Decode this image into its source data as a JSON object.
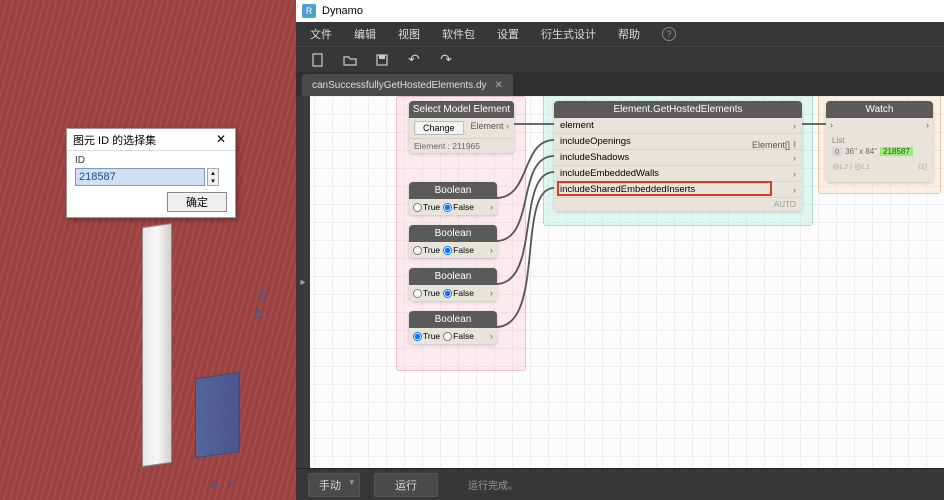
{
  "dialog": {
    "title": "图元 ID 的选择集",
    "id_label": "ID",
    "id_value": "218587",
    "ok_label": "确定"
  },
  "revit": {
    "dim1": "13' - 0\"",
    "dim2": "3' - 9\""
  },
  "dynamo": {
    "app_title": "Dynamo",
    "menu": {
      "file": "文件",
      "edit": "编辑",
      "view": "视图",
      "packages": "软件包",
      "settings": "设置",
      "generative": "衍生式设计",
      "help": "帮助"
    },
    "tab": {
      "name": "canSuccessfullyGetHostedElements.dy"
    },
    "nodes": {
      "select": {
        "title": "Select Model Element",
        "button": "Change",
        "out": "Element",
        "value": "Element : 211965"
      },
      "boolean": {
        "title": "Boolean",
        "true_label": "True",
        "false_label": "False"
      },
      "hosted": {
        "title": "Element.GetHostedElements",
        "ports": {
          "element": "element",
          "includeOpenings": "includeOpenings",
          "includeShadows": "includeShadows",
          "includeEmbeddedWalls": "includeEmbeddedWalls",
          "includeSharedEmbeddedInserts": "includeSharedEmbeddedInserts"
        },
        "out": "Element[]",
        "auto": "AUTO"
      },
      "watch": {
        "title": "Watch",
        "list_label": "List",
        "item_idx": "0",
        "item_text": "36\" x 84\"",
        "item_id": "218587",
        "footer_left": "@L2 | @L1",
        "footer_right": "{1}"
      }
    },
    "statusbar": {
      "mode": "手动",
      "run": "运行",
      "status": "运行完成。"
    }
  }
}
